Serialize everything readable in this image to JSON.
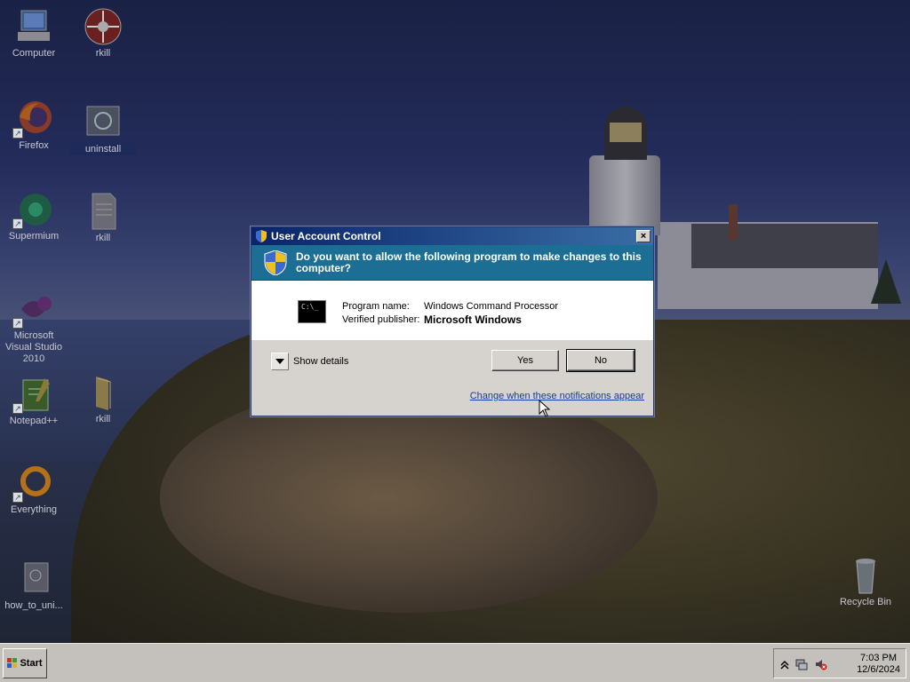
{
  "desktop": {
    "icons": [
      {
        "label": "Computer"
      },
      {
        "label": "rkill"
      },
      {
        "label": "Firefox"
      },
      {
        "label": "uninstall"
      },
      {
        "label": "Supermium"
      },
      {
        "label": "rkill"
      },
      {
        "label": "Microsoft Visual Studio 2010"
      },
      {
        "label": "Notepad++"
      },
      {
        "label": "rkill"
      },
      {
        "label": "Everything"
      },
      {
        "label": "how_to_uni..."
      },
      {
        "label": "Recycle Bin"
      }
    ]
  },
  "uac": {
    "title": "User Account Control",
    "close_glyph": "×",
    "question": "Do you want to allow the following program to make changes to this computer?",
    "program_name_label": "Program name:",
    "program_name": "Windows Command Processor",
    "publisher_label": "Verified publisher:",
    "publisher": "Microsoft Windows",
    "cmd_icon_text": "C:\\_",
    "show_details": "Show details",
    "yes_label": "Yes",
    "no_label": "No",
    "notifications_link": "Change when these notifications appear"
  },
  "taskbar": {
    "start_label": "Start",
    "clock_time": "7:03 PM",
    "clock_date": "12/6/2024"
  },
  "colors": {
    "banner": "#1c6e95",
    "title_bar_start": "#0a246a",
    "link": "#1a3aa0"
  }
}
